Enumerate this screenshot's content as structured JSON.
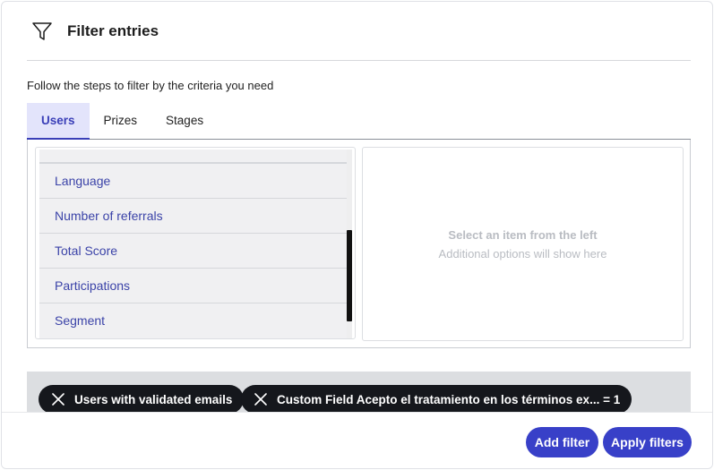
{
  "header": {
    "title": "Filter entries",
    "icon": "filter-icon"
  },
  "subtitle": "Follow the steps to filter by the criteria you need",
  "tabs": [
    {
      "label": "Users",
      "active": true
    },
    {
      "label": "Prizes",
      "active": false
    },
    {
      "label": "Stages",
      "active": false
    }
  ],
  "list": {
    "items": [
      "Language",
      "Number of referrals",
      "Total Score",
      "Participations",
      "Segment"
    ]
  },
  "detail": {
    "placeholder_title": "Select an item from the left",
    "placeholder_subtitle": "Additional options will show here"
  },
  "active_filters": [
    {
      "label": "Users with validated emails"
    },
    {
      "label": "Custom Field Acepto el tratamiento en los términos ex... = 1"
    }
  ],
  "footer": {
    "add_filter": "Add filter",
    "apply_filters": "Apply filters"
  },
  "colors": {
    "accent": "#3840c8",
    "link": "#3b43a8",
    "chip": "#15171c",
    "tab_active_bg": "#e3e4fb"
  }
}
